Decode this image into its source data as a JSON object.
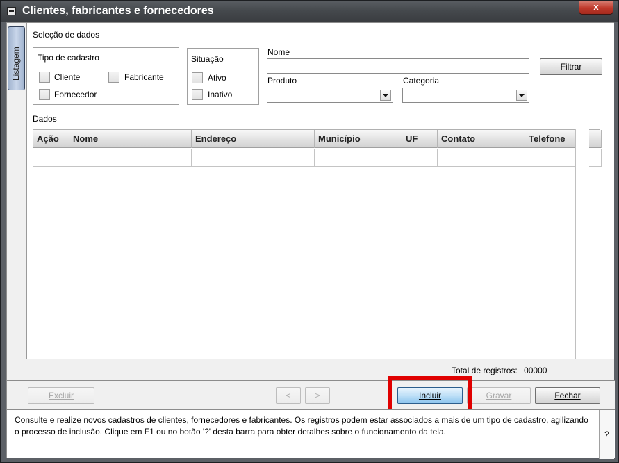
{
  "window": {
    "title": "Clientes, fabricantes e fornecedores",
    "close_label": "x"
  },
  "side_tab": {
    "label": "Listagem"
  },
  "selecao": {
    "title": "Seleção de dados",
    "tipo_cadastro": {
      "label": "Tipo de cadastro",
      "options": [
        "Cliente",
        "Fabricante",
        "Fornecedor"
      ]
    },
    "situacao": {
      "label": "Situação",
      "options": [
        "Ativo",
        "Inativo"
      ]
    },
    "nome": {
      "label": "Nome",
      "value": ""
    },
    "produto": {
      "label": "Produto",
      "value": ""
    },
    "categoria": {
      "label": "Categoria",
      "value": ""
    },
    "filtrar_label": "Filtrar"
  },
  "dados": {
    "title": "Dados",
    "columns": [
      "Ação",
      "Nome",
      "Endereço",
      "Município",
      "UF",
      "Contato",
      "Telefone"
    ],
    "total_label": "Total de registros:",
    "total_value": "00000"
  },
  "buttons": {
    "excluir": "Excluir",
    "prev": "<",
    "next": ">",
    "incluir": "Incluir",
    "gravar": "Gravar",
    "fechar": "Fechar"
  },
  "info": {
    "text": "Consulte e realize novos cadastros de clientes, fornecedores e fabricantes. Os registros podem estar associados a mais de um tipo de cadastro, agilizando o processo de inclusão. Clique em F1 ou no botão '?' desta barra para obter detalhes sobre o funcionamento da tela.",
    "help_label": "?"
  },
  "colors": {
    "title_bar": "#44484c",
    "highlight": "#e00000",
    "close_button": "#c0392b",
    "primary_button": "#3b8fd6"
  }
}
